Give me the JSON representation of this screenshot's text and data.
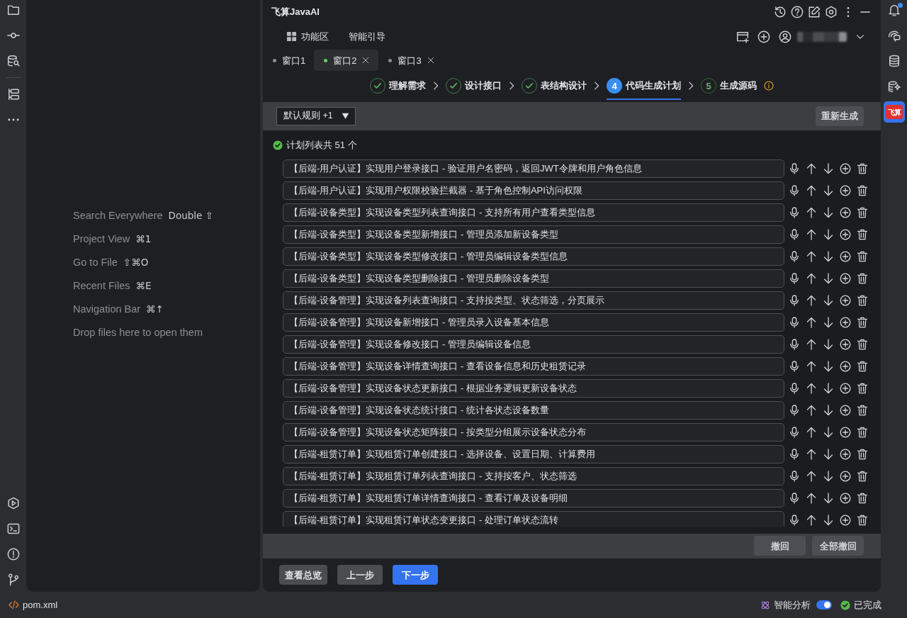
{
  "window": {
    "title": "飞算JavaAI"
  },
  "editor_empty": {
    "hints": [
      {
        "label": "Search Everywhere",
        "shortcut": "Double ⇧"
      },
      {
        "label": "Project View",
        "shortcut": "⌘1"
      },
      {
        "label": "Go to File",
        "shortcut": "⇧⌘O"
      },
      {
        "label": "Recent Files",
        "shortcut": "⌘E"
      },
      {
        "label": "Navigation Bar",
        "shortcut": "⌘↑"
      },
      {
        "label": "Drop files here to open them"
      }
    ]
  },
  "menu": [
    {
      "label": "功能区",
      "has_icon": true
    },
    {
      "label": "智能引导",
      "has_icon": false
    }
  ],
  "tabs": [
    {
      "label": "窗口1",
      "selected": false,
      "closable": false
    },
    {
      "label": "窗口2",
      "selected": true,
      "closable": true
    },
    {
      "label": "窗口3",
      "selected": false,
      "closable": true
    }
  ],
  "stepper": {
    "warning": true,
    "steps": [
      {
        "label": "理解需求",
        "kind": "done",
        "selected": false
      },
      {
        "label": "设计接口",
        "kind": "done",
        "selected": false
      },
      {
        "label": "表结构设计",
        "kind": "done",
        "selected": false
      },
      {
        "number": "4",
        "label": "代码生成计划",
        "kind": "active",
        "selected": true
      },
      {
        "number": "5",
        "label": "生成源码",
        "kind": "pending",
        "selected": false
      }
    ]
  },
  "toolbar": {
    "rule_dropdown": {
      "value": "默认规则 +1"
    },
    "regenerate_button": "重新生成"
  },
  "plan": {
    "summary": "计划列表共 51 个",
    "items": [
      "【后端-用户认证】实现用户登录接口 - 验证用户名密码，返回JWT令牌和用户角色信息",
      "【后端-用户认证】实现用户权限校验拦截器 - 基于角色控制API访问权限",
      "【后端-设备类型】实现设备类型列表查询接口 - 支持所有用户查看类型信息",
      "【后端-设备类型】实现设备类型新增接口 - 管理员添加新设备类型",
      "【后端-设备类型】实现设备类型修改接口 - 管理员编辑设备类型信息",
      "【后端-设备类型】实现设备类型删除接口 - 管理员删除设备类型",
      "【后端-设备管理】实现设备列表查询接口 - 支持按类型、状态筛选，分页展示",
      "【后端-设备管理】实现设备新增接口 - 管理员录入设备基本信息",
      "【后端-设备管理】实现设备修改接口 - 管理员编辑设备信息",
      "【后端-设备管理】实现设备详情查询接口 - 查看设备信息和历史租赁记录",
      "【后端-设备管理】实现设备状态更新接口 - 根据业务逻辑更新设备状态",
      "【后端-设备管理】实现设备状态统计接口 - 统计各状态设备数量",
      "【后端-设备管理】实现设备状态矩阵接口 - 按类型分组展示设备状态分布",
      "【后端-租赁订单】实现租赁订单创建接口 - 选择设备、设置日期、计算费用",
      "【后端-租赁订单】实现租赁订单列表查询接口 - 支持按客户、状态筛选",
      "【后端-租赁订单】实现租赁订单详情查询接口 - 查看订单及设备明细",
      "【后端-租赁订单】实现租赁订单状态变更接口 - 处理订单状态流转"
    ]
  },
  "actions": {
    "buttons": [
      "撤回",
      "全部撤回"
    ]
  },
  "footer": {
    "buttons": [
      {
        "label": "查看总览",
        "kind": "secondary"
      },
      {
        "label": "上一步",
        "kind": "secondary"
      },
      {
        "label": "下一步",
        "kind": "primary"
      }
    ]
  },
  "status_bar": {
    "file": "pom.xml",
    "analysis": {
      "label": "智能分析",
      "on": true
    },
    "status": "已完成"
  },
  "right_toolbar": {
    "notifications_unread": true,
    "plugin_logo": {
      "text": "飞算",
      "selected": true
    }
  }
}
